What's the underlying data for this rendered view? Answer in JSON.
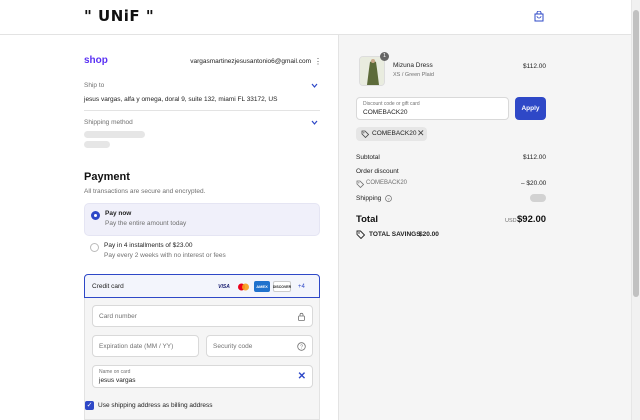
{
  "header": {
    "logo": "\" UNiF \""
  },
  "checkout": {
    "shop_pay": "shop",
    "email": "vargasmartinezjesusantonio6@gmail.com",
    "ship_to": {
      "label": "Ship to",
      "value": "jesus vargas, alfa y omega, doral 9, suite 132, miami FL 33172, US"
    },
    "shipping_method": {
      "label": "Shipping method"
    }
  },
  "payment": {
    "title": "Payment",
    "subtitle": "All transactions are secure and encrypted.",
    "options": [
      {
        "title": "Pay now",
        "subtitle": "Pay the entire amount today",
        "selected": true
      },
      {
        "title": "Pay in 4 installments of $23.00",
        "subtitle": "Pay every 2 weeks with no interest or fees",
        "selected": false
      }
    ],
    "credit_card": {
      "label": "Credit card",
      "card_logos": [
        "VISA",
        "mastercard",
        "AMEX",
        "DISCOVER"
      ],
      "more": "+4",
      "card_number_ph": "Card number",
      "expiry_ph": "Expiration date (MM / YY)",
      "security_ph": "Security code",
      "name_label": "Name on card",
      "name_value": "jesus vargas"
    },
    "billing_checkbox": {
      "label": "Use shipping address as billing address",
      "checked": true
    }
  },
  "summary": {
    "product": {
      "name": "Mizuna Dress",
      "variant": "XS / Green Plaid",
      "price": "$112.00",
      "qty": "1"
    },
    "discount_input": {
      "label": "Discount code or gift card",
      "value": "COMEBACK20"
    },
    "apply": "Apply",
    "applied_code": "COMEBACK20",
    "subtotal": {
      "label": "Subtotal",
      "value": "$112.00"
    },
    "order_discount": {
      "label": "Order discount",
      "code": "COMEBACK20",
      "value": "– $20.00"
    },
    "shipping": {
      "label": "Shipping"
    },
    "total": {
      "label": "Total",
      "currency": "USD",
      "value": "$92.00"
    },
    "savings": {
      "label": "TOTAL SAVINGS",
      "value": "$20.00"
    }
  },
  "colors": {
    "accent": "#2e48c7",
    "shop_pay": "#5a31f4"
  }
}
